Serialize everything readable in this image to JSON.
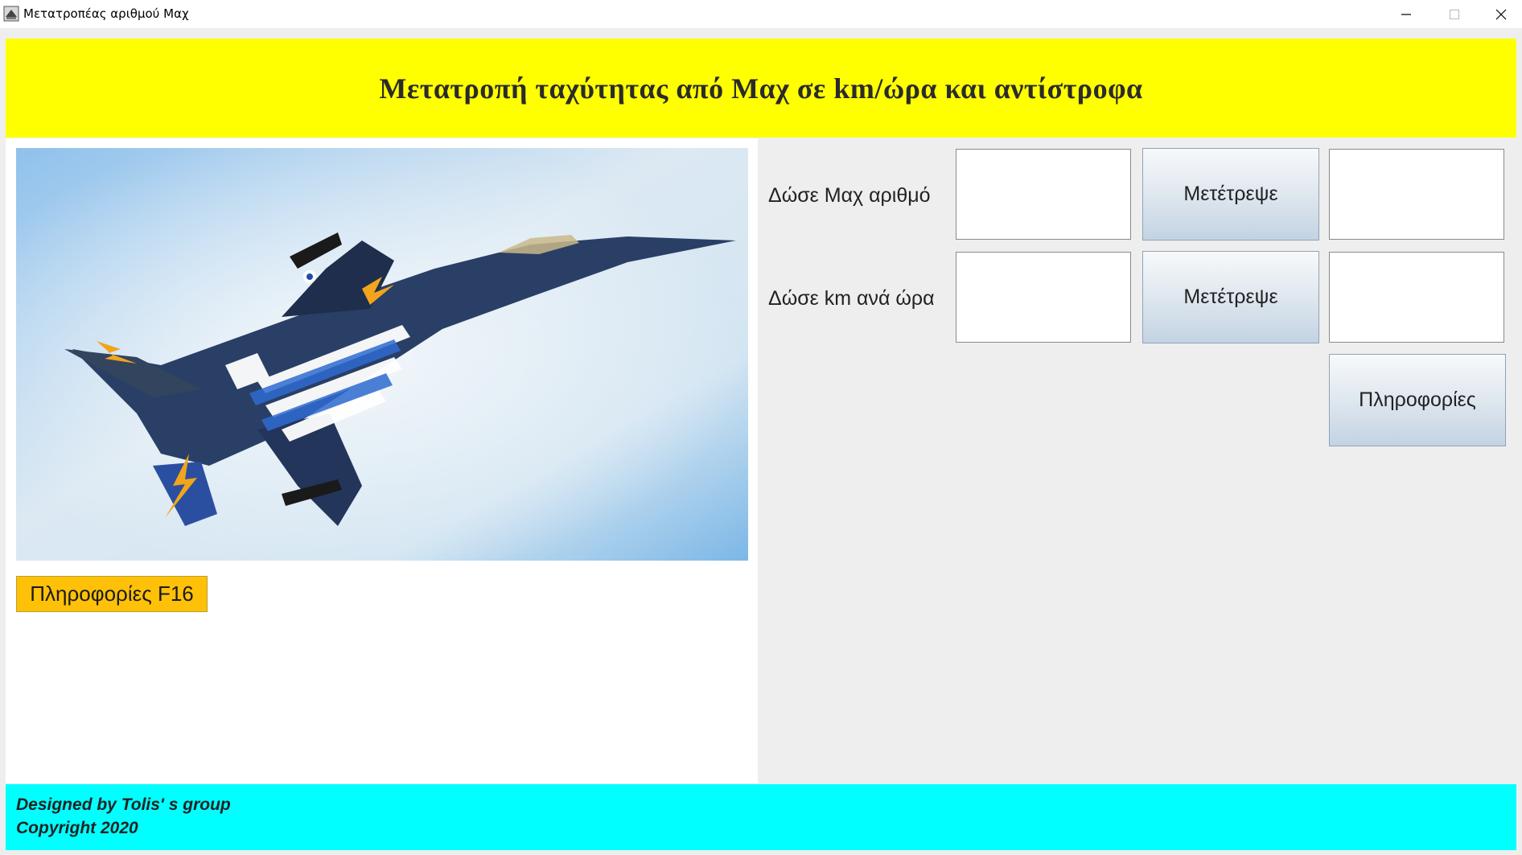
{
  "window": {
    "title": "Μετατροπέας αριθμού Μαχ",
    "controls": [
      "minimize-icon",
      "maximize-icon",
      "close-icon"
    ]
  },
  "header": {
    "title": "Μετατροπή ταχύτητας από Μαχ σε km/ώρα και αντίστροφα",
    "background": "#ffff00"
  },
  "left": {
    "image_alt": "F-16 fighter jet in Greek flag livery",
    "info_button": "Πληροφορίες F16",
    "info_button_color": "#ffc107"
  },
  "converter": {
    "mach_label": "Δώσε Μαχ αριθμό",
    "mach_input": "",
    "mach_result": "",
    "kmh_label": "Δώσε km ανά ώρα",
    "kmh_input": "",
    "kmh_result": "",
    "convert_label": "Μετέτρεψε",
    "info_label": "Πληροφορίες"
  },
  "footer": {
    "line1": "Designed by Tolis' s group",
    "line2": "Copyright 2020",
    "background": "#00ffff"
  }
}
